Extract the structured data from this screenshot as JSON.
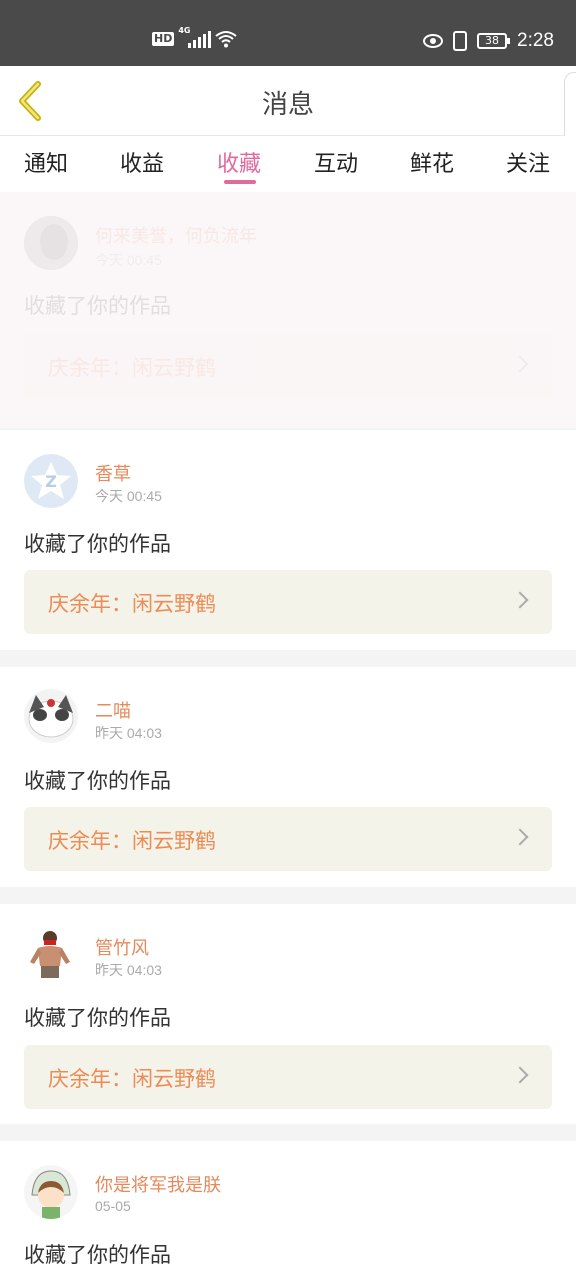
{
  "status_bar": {
    "hd": "HD",
    "network": "4G",
    "battery": "38",
    "time": "2:28"
  },
  "header": {
    "title": "消息",
    "back_icon": "chevron-left-icon"
  },
  "tabs": [
    {
      "label": "通知",
      "active": false
    },
    {
      "label": "收益",
      "active": false
    },
    {
      "label": "收藏",
      "active": true
    },
    {
      "label": "互动",
      "active": false
    },
    {
      "label": "鲜花",
      "active": false
    },
    {
      "label": "关注",
      "active": false
    }
  ],
  "messages": [
    {
      "user": "何来美誉，何负流年",
      "time": "今天 00:45",
      "action": "收藏了你的作品",
      "work": "庆余年：闲云野鹤"
    },
    {
      "user": "香草",
      "time": "今天 00:45",
      "action": "收藏了你的作品",
      "work": "庆余年：闲云野鹤"
    },
    {
      "user": "二喵",
      "time": "昨天 04:03",
      "action": "收藏了你的作品",
      "work": "庆余年：闲云野鹤"
    },
    {
      "user": "管竹风",
      "time": "昨天 04:03",
      "action": "收藏了你的作品",
      "work": "庆余年：闲云野鹤"
    },
    {
      "user": "你是将军我是朕",
      "time": "05-05",
      "action": "收藏了你的作品",
      "work": ""
    }
  ],
  "colors": {
    "accent": "#e06a9d",
    "username": "#e48a5c",
    "work_title": "#ec8b54",
    "work_bg": "#f4f3ea"
  }
}
